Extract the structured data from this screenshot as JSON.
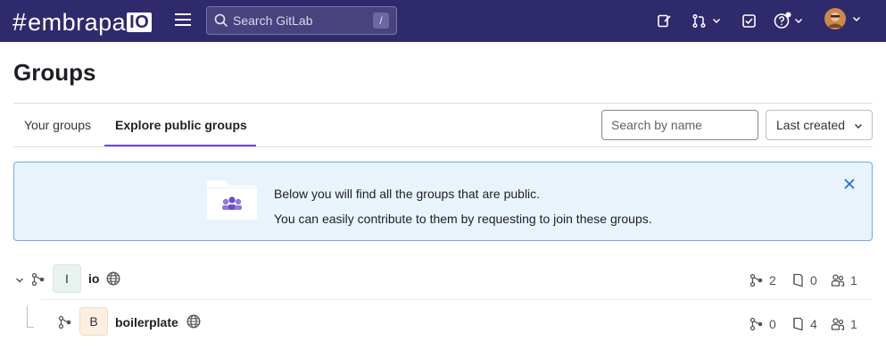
{
  "navbar": {
    "logo_hash": "#",
    "logo_text": "embrapa",
    "logo_badge": "IO",
    "search_placeholder": "Search GitLab",
    "search_shortcut": "/"
  },
  "page": {
    "title": "Groups",
    "tabs": [
      {
        "label": "Your groups",
        "active": false
      },
      {
        "label": "Explore public groups",
        "active": true
      }
    ],
    "filter_placeholder": "Search by name",
    "sort_label": "Last created"
  },
  "banner": {
    "line1": "Below you will find all the groups that are public.",
    "line2": "You can easily contribute to them by requesting to join these groups."
  },
  "groups": [
    {
      "avatar": "I",
      "name": "io",
      "subgroups": "2",
      "projects": "0",
      "members": "1",
      "expanded": true
    },
    {
      "avatar": "B",
      "name": "boilerplate",
      "subgroups": "0",
      "projects": "4",
      "members": "1"
    }
  ],
  "colors": {
    "navbar": "#2f2a6b",
    "accent": "#6e49cb",
    "banner_bg": "#e9f3fc",
    "banner_border": "#74a9e4"
  }
}
